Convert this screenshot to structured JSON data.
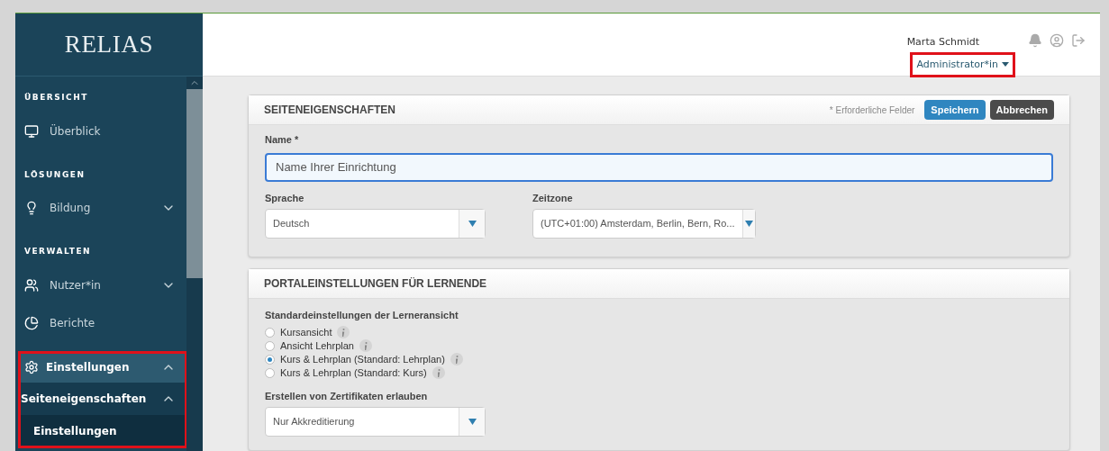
{
  "logo": "RELIAS",
  "sidebar": {
    "sections": [
      {
        "heading": "ÜBERSICHT",
        "items": [
          {
            "label": "Überblick"
          }
        ]
      },
      {
        "heading": "LÖSUNGEN",
        "items": [
          {
            "label": "Bildung",
            "expanded": false
          }
        ]
      },
      {
        "heading": "VERWALTEN",
        "items": [
          {
            "label": "Nutzer*in",
            "expanded": false
          },
          {
            "label": "Berichte"
          },
          {
            "label": "Einstellungen",
            "expanded": true,
            "selected": true,
            "children": [
              {
                "label": "Seiteneigenschaften",
                "expanded": true,
                "children": [
                  {
                    "label": "Einstellungen",
                    "selected": true
                  }
                ]
              }
            ]
          }
        ]
      }
    ],
    "highlighted": true
  },
  "user": {
    "name": "Marta Schmidt",
    "role": "Administrator*in",
    "role_highlighted": true
  },
  "panels": [
    {
      "title": "SEITENEIGENSCHAFTEN",
      "required_note": "* Erforderliche Felder",
      "buttons": [
        {
          "label": "Speichern",
          "kind": "primary"
        },
        {
          "label": "Abbrechen",
          "kind": "secondary"
        }
      ],
      "name_field": {
        "label": "Name *",
        "value": "Name Ihrer Einrichtung",
        "focused": true
      },
      "selects": [
        {
          "label": "Sprache",
          "value": "Deutsch"
        },
        {
          "label": "Zeitzone",
          "value": "(UTC+01:00) Amsterdam, Berlin, Bern, Ro..."
        }
      ]
    },
    {
      "title": "PORTALEINSTELLUNGEN FÜR LERNENDE",
      "radio_group": {
        "label": "Standardeinstellungen der Lerneransicht",
        "options": [
          {
            "label": "Kursansicht",
            "selected": false
          },
          {
            "label": "Ansicht Lehrplan",
            "selected": false
          },
          {
            "label": "Kurs & Lehrplan (Standard: Lehrplan)",
            "selected": true
          },
          {
            "label": "Kurs & Lehrplan (Standard: Kurs)",
            "selected": false
          }
        ]
      },
      "certificate_select": {
        "label": "Erstellen von Zertifikaten erlauben",
        "value": "Nur Akkreditierung"
      }
    }
  ]
}
